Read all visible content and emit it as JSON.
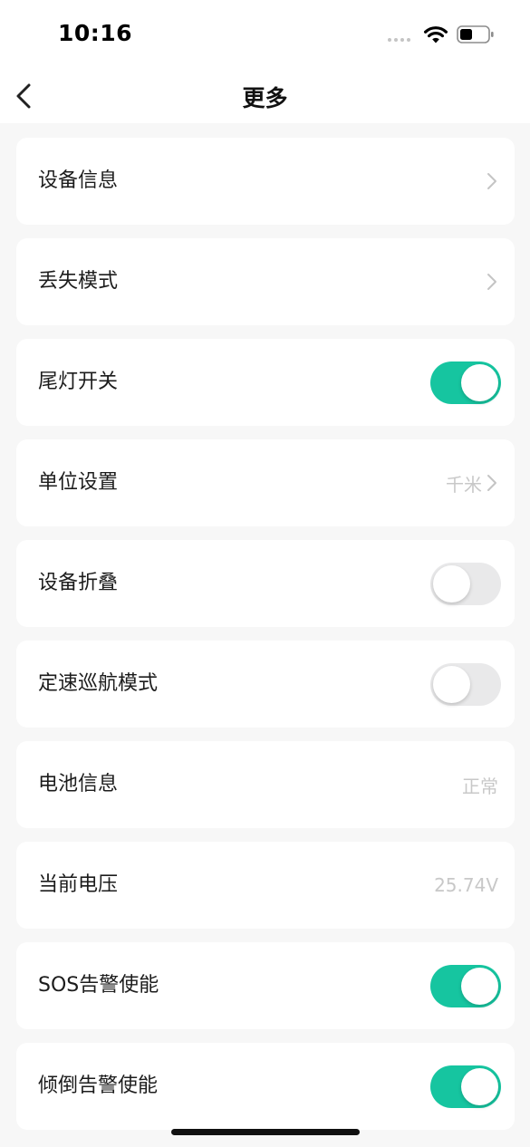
{
  "status_bar": {
    "time": "10:16"
  },
  "nav": {
    "title": "更多",
    "back_icon": "chevron-left-icon"
  },
  "items": [
    {
      "label": "设备信息",
      "type": "link",
      "value": ""
    },
    {
      "label": "丢失模式",
      "type": "link",
      "value": ""
    },
    {
      "label": "尾灯开关",
      "type": "toggle",
      "on": true
    },
    {
      "label": "单位设置",
      "type": "link",
      "value": "千米"
    },
    {
      "label": "设备折叠",
      "type": "toggle",
      "on": false
    },
    {
      "label": "定速巡航模式",
      "type": "toggle",
      "on": false
    },
    {
      "label": "电池信息",
      "type": "value",
      "value": "正常"
    },
    {
      "label": "当前电压",
      "type": "value",
      "value": "25.74V"
    },
    {
      "label": "SOS告警使能",
      "type": "toggle",
      "on": true
    },
    {
      "label": "倾倒告警使能",
      "type": "toggle",
      "on": true
    }
  ],
  "colors": {
    "toggle_on": "#16c5a0",
    "toggle_off": "#e9e9ea",
    "background": "#f7f7f7"
  }
}
